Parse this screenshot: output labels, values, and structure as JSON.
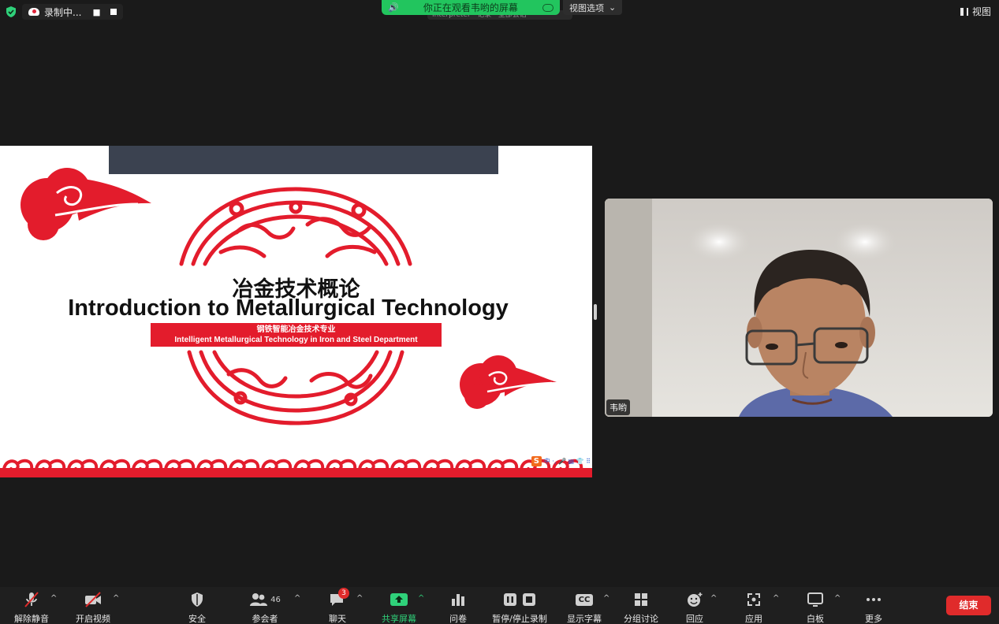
{
  "top_bar": {
    "recording_label": "录制中...",
    "viewing_banner": "你正在观看韦哟的屏幕",
    "sub_banner": "Interpreter · 记录 · 全部会话",
    "view_options_label": "视图选项",
    "view_label": "视图"
  },
  "slide": {
    "title_cn": "冶金技术概论",
    "title_en": "Introduction to Metallurgical Technology",
    "subtitle_cn": "钢铁智能冶金技术专业",
    "subtitle_en": "Intelligent Metallurgical Technology in Iron and Steel Department",
    "ime_logo": "S",
    "ime_text": "中 ·, 🎤 ▤ 👕 ⠿",
    "colors": {
      "red": "#e31c2c",
      "topbar": "#3b4250"
    }
  },
  "video": {
    "participant_name": "韦哟"
  },
  "toolbar": {
    "unmute": "解除静音",
    "start_video": "开启视频",
    "security": "安全",
    "participants": "参会者",
    "participants_count": "46",
    "chat": "聊天",
    "chat_badge": "3",
    "share_screen": "共享屏幕",
    "polls": "问卷",
    "record": "暂停/停止录制",
    "captions": "显示字幕",
    "captions_icon": "CC",
    "breakout": "分组讨论",
    "reactions": "回应",
    "apps": "应用",
    "whiteboard": "白板",
    "more": "更多",
    "end": "结束",
    "accent_green": "#2fd17a",
    "end_red": "#e02b2b"
  }
}
